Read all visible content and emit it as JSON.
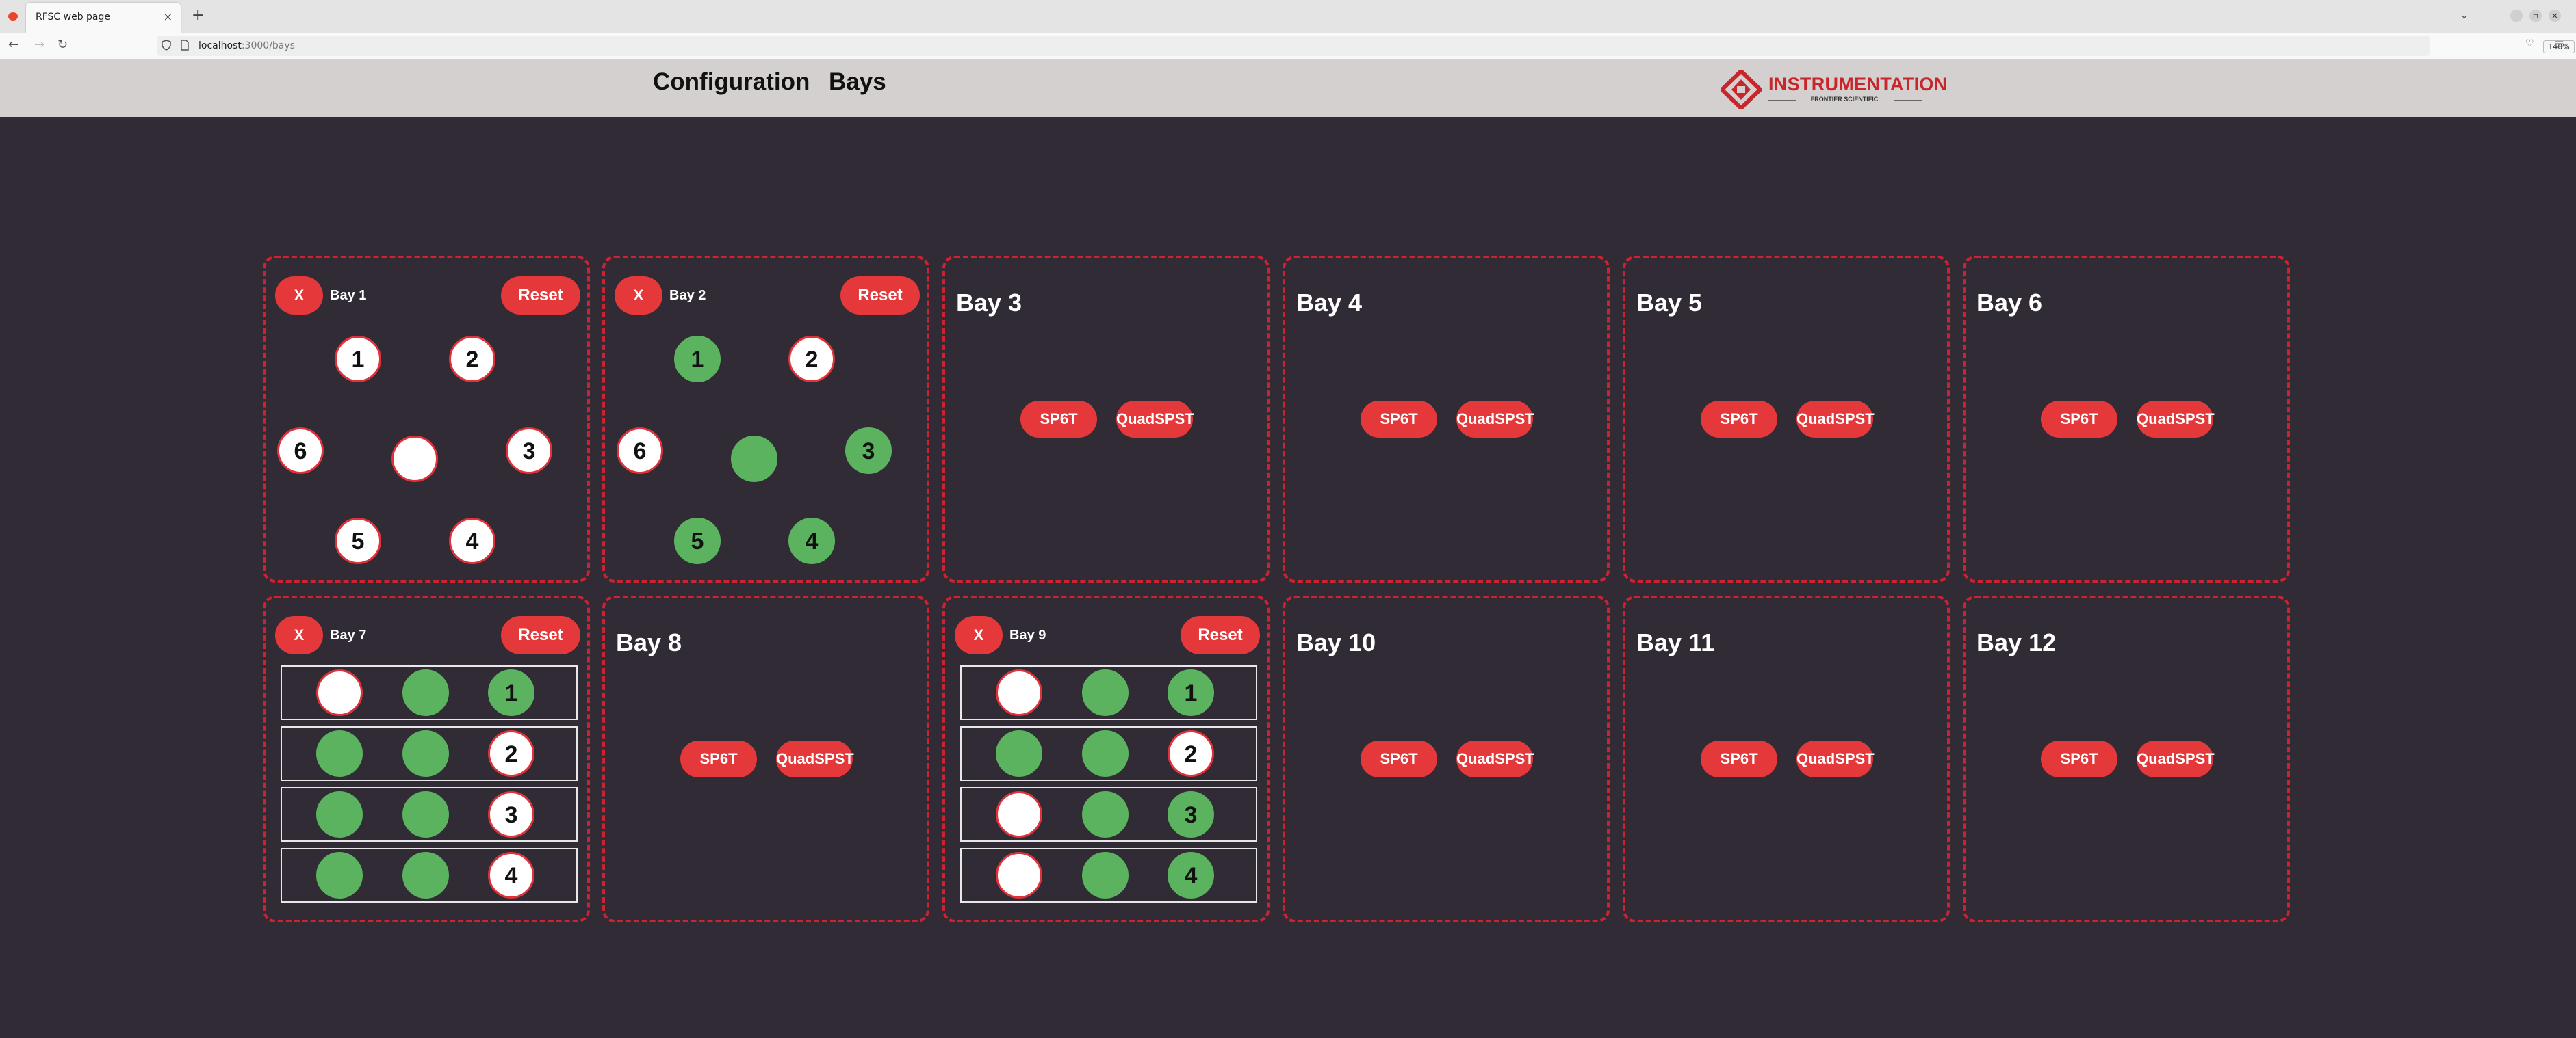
{
  "browser": {
    "tab_title": "RFSC web page",
    "tab_close": "×",
    "new_tab": "+",
    "tabs_dropdown": "⌄",
    "url_host": "localhost",
    "url_path": ":3000/bays",
    "zoom": "140%",
    "back": "←",
    "forward": "→",
    "reload": "↻",
    "star": "☆",
    "menu": "≡",
    "pocket": "♡",
    "win_min": "–",
    "win_max": "▫",
    "win_close": "×"
  },
  "header": {
    "nav": [
      "Configuration",
      "Bays"
    ],
    "logo": {
      "title": "INSTRUMENTATION",
      "subtitle": "FRONTIER SCIENTIFIC",
      "brand_color": "#c8262a"
    }
  },
  "colors": {
    "accent": "#e5383b",
    "port_active": "#5bb35f",
    "port_inactive": "#ffffff",
    "border": "#cc2231"
  },
  "bays": [
    {
      "name": "Bay 1",
      "x_label": "X",
      "reset_label": "Reset",
      "ports": [
        {
          "label": "1",
          "active": false
        },
        {
          "label": "2",
          "active": false
        },
        {
          "label": "3",
          "active": false
        },
        {
          "label": "4",
          "active": false
        },
        {
          "label": "5",
          "active": false
        },
        {
          "label": "6",
          "active": false
        },
        {
          "label": "",
          "active": false
        }
      ]
    },
    {
      "name": "Bay 2",
      "x_label": "X",
      "reset_label": "Reset",
      "ports": [
        {
          "label": "1",
          "active": true
        },
        {
          "label": "2",
          "active": false
        },
        {
          "label": "3",
          "active": true
        },
        {
          "label": "4",
          "active": true
        },
        {
          "label": "5",
          "active": true
        },
        {
          "label": "6",
          "active": false
        },
        {
          "label": "",
          "active": true
        }
      ]
    },
    {
      "name": "Bay 3",
      "options": [
        "SP6T",
        "QuadSPST"
      ]
    },
    {
      "name": "Bay 4",
      "options": [
        "SP6T",
        "QuadSPST"
      ]
    },
    {
      "name": "Bay 5",
      "options": [
        "SP6T",
        "QuadSPST"
      ]
    },
    {
      "name": "Bay 6",
      "options": [
        "SP6T",
        "QuadSPST"
      ]
    },
    {
      "name": "Bay 7",
      "x_label": "X",
      "reset_label": "Reset",
      "rows": [
        [
          {
            "label": "",
            "active": false
          },
          {
            "label": "",
            "active": true
          },
          {
            "label": "1",
            "active": true
          }
        ],
        [
          {
            "label": "",
            "active": true
          },
          {
            "label": "",
            "active": true
          },
          {
            "label": "2",
            "active": false
          }
        ],
        [
          {
            "label": "",
            "active": true
          },
          {
            "label": "",
            "active": true
          },
          {
            "label": "3",
            "active": false
          }
        ],
        [
          {
            "label": "",
            "active": true
          },
          {
            "label": "",
            "active": true
          },
          {
            "label": "4",
            "active": false
          }
        ]
      ]
    },
    {
      "name": "Bay 8",
      "options": [
        "SP6T",
        "QuadSPST"
      ]
    },
    {
      "name": "Bay 9",
      "x_label": "X",
      "reset_label": "Reset",
      "rows": [
        [
          {
            "label": "",
            "active": false
          },
          {
            "label": "",
            "active": true
          },
          {
            "label": "1",
            "active": true
          }
        ],
        [
          {
            "label": "",
            "active": true
          },
          {
            "label": "",
            "active": true
          },
          {
            "label": "2",
            "active": false
          }
        ],
        [
          {
            "label": "",
            "active": false
          },
          {
            "label": "",
            "active": true
          },
          {
            "label": "3",
            "active": true
          }
        ],
        [
          {
            "label": "",
            "active": false
          },
          {
            "label": "",
            "active": true
          },
          {
            "label": "4",
            "active": true
          }
        ]
      ]
    },
    {
      "name": "Bay 10",
      "options": [
        "SP6T",
        "QuadSPST"
      ]
    },
    {
      "name": "Bay 11",
      "options": [
        "SP6T",
        "QuadSPST"
      ]
    },
    {
      "name": "Bay 12",
      "options": [
        "SP6T",
        "QuadSPST"
      ]
    }
  ]
}
